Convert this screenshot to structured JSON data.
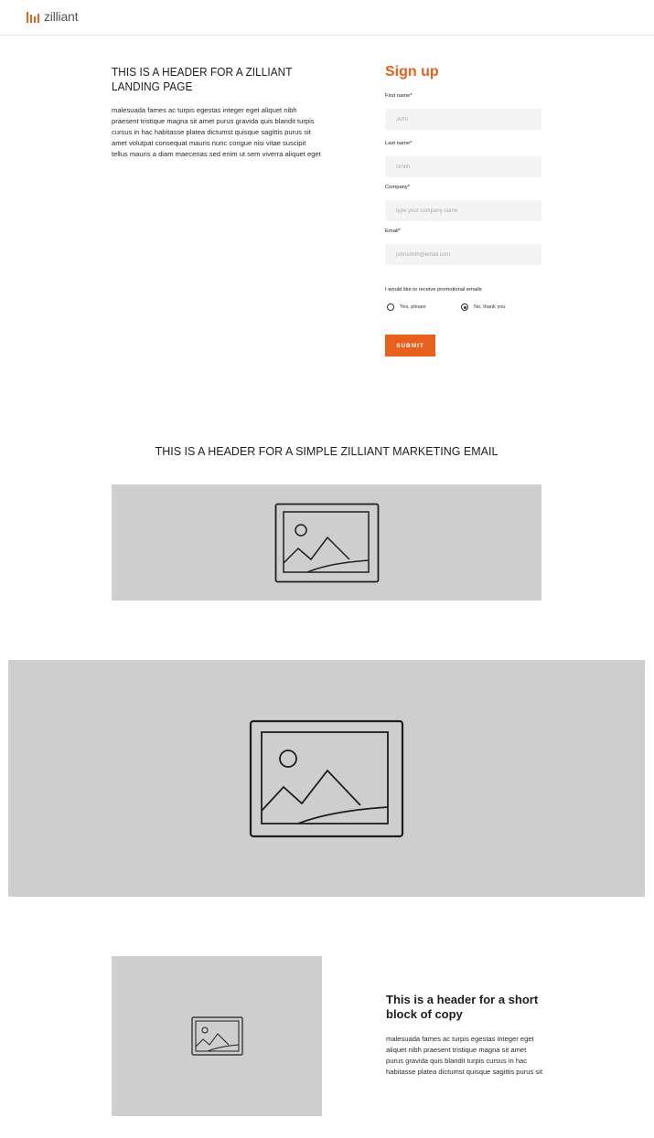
{
  "brand": {
    "name": "zilliant",
    "accent_color": "#e8611c"
  },
  "landing": {
    "header": "THIS IS A HEADER FOR A ZILLIANT LANDING PAGE",
    "copy": "malesuada fames ac turpis egestas integer eget aliquet nibh praesent tristique magna sit amet purus gravida quis blandit turpis cursus in hac habitasse platea dictumst quisque sagittis purus sit amet volutpat consequat mauris nunc congue nisi vitae suscipit tellus mauris a diam maecenas sed enim ut sem viverra aliquet eget"
  },
  "signup": {
    "title": "Sign up",
    "fields": [
      {
        "label": "First name*",
        "placeholder": "John"
      },
      {
        "label": "Last name*",
        "placeholder": "Smith"
      },
      {
        "label": "Company*",
        "placeholder": "type your company name"
      },
      {
        "label": "Email*",
        "placeholder": "johnsmith@email.com"
      }
    ],
    "promo_label": "I would like to receive promotional emails",
    "options": [
      {
        "label": "Yes, please",
        "checked": false
      },
      {
        "label": "No, thank you",
        "checked": true
      }
    ],
    "submit_label": "SUBMIT"
  },
  "email_section": {
    "header": "THIS IS A HEADER FOR A SIMPLE ZILLIANT MARKETING EMAIL"
  },
  "short_block": {
    "header": "This is a header for a short block of copy",
    "copy": "malesuada fames ac turpis egestas integer eget aliquet nibh praesent tristique magna sit amet purus gravida quis blandit turpis cursus in hac habitasse platea dictumst quisque sagittis purus sit"
  }
}
